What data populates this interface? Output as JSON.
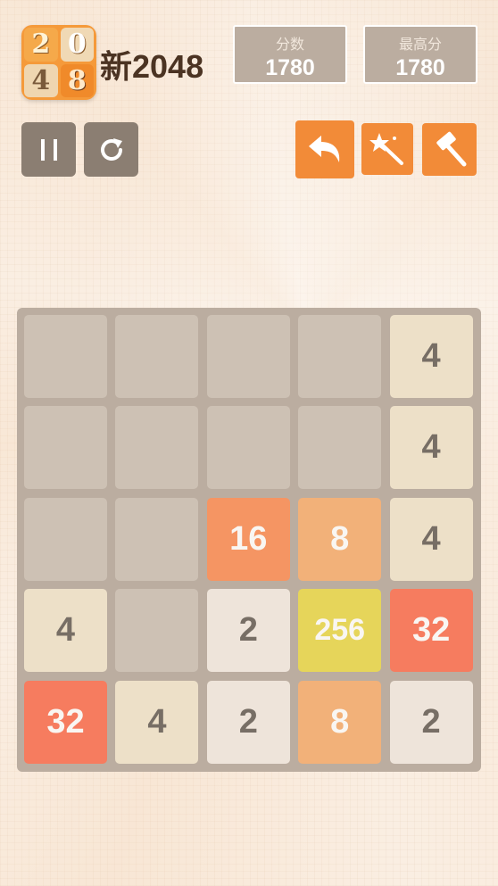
{
  "logo": {
    "tiles": [
      "2",
      "0",
      "4",
      "8"
    ]
  },
  "title": "新2048",
  "score": {
    "label": "分数",
    "value": "1780"
  },
  "best": {
    "label": "最高分",
    "value": "1780"
  },
  "controls": {
    "pause_icon": "pause-icon",
    "restart_icon": "restart-icon"
  },
  "tools": {
    "undo_icon": "undo-icon",
    "magic_icon": "magic-wand-icon",
    "hammer_icon": "hammer-icon"
  },
  "colors": {
    "board": "#bbada0",
    "empty_cell": "#cdc1b4",
    "tool_button": "#f28b38",
    "control_button": "#8b7e72"
  },
  "board": {
    "rows": [
      [
        "",
        "",
        "",
        "",
        "4"
      ],
      [
        "",
        "",
        "",
        "",
        "4"
      ],
      [
        "",
        "",
        "16",
        "8",
        "4"
      ],
      [
        "4",
        "",
        "2",
        "256",
        "32"
      ],
      [
        "32",
        "4",
        "2",
        "8",
        "2"
      ]
    ]
  }
}
